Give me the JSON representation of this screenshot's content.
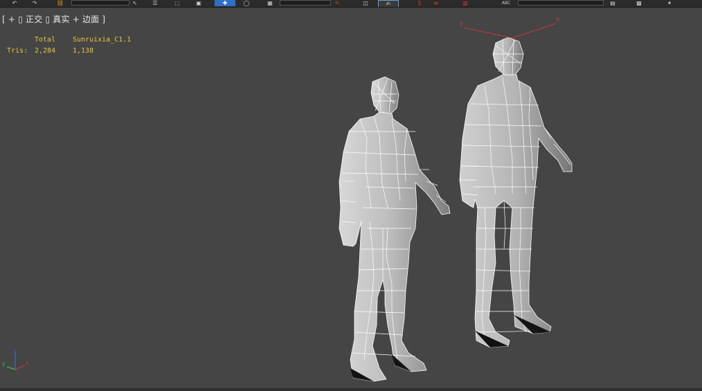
{
  "toolbar": {
    "items": [
      {
        "name": "undo-icon",
        "glyph": "↶"
      },
      {
        "name": "redo-icon",
        "glyph": "↷"
      },
      {
        "name": "link-icon",
        "glyph": "⛓"
      },
      {
        "name": "select-object-icon",
        "glyph": "↖"
      },
      {
        "name": "select-by-name-icon",
        "glyph": "☰"
      },
      {
        "name": "rect-selection-icon",
        "glyph": "⬚"
      },
      {
        "name": "window-crossing-icon",
        "glyph": "▣"
      },
      {
        "name": "move-icon",
        "glyph": "✚"
      },
      {
        "name": "rotate-icon",
        "glyph": "◯"
      },
      {
        "name": "reference-coord-icon",
        "glyph": "▦"
      },
      {
        "name": "snap-icon",
        "glyph": "✎"
      },
      {
        "name": "mirror-icon",
        "glyph": "◫"
      },
      {
        "name": "named-selection-icon",
        "glyph": "✍"
      },
      {
        "name": "align-icon",
        "glyph": "⫼"
      },
      {
        "name": "layer-icon",
        "glyph": "≡"
      },
      {
        "name": "abc-icon",
        "glyph": "ABC"
      },
      {
        "name": "curve-editor-icon",
        "glyph": "▥"
      },
      {
        "name": "render-setup-icon",
        "glyph": "▤"
      },
      {
        "name": "render-frame-icon",
        "glyph": "▩"
      },
      {
        "name": "render-icon",
        "glyph": "✦"
      }
    ],
    "colors": {
      "active": "#2f6fc6"
    }
  },
  "viewport": {
    "label_bracket_open": "[",
    "label_plus": "+",
    "label_view_marker": "▯",
    "label_view": "正交",
    "label_shading_marker": "▯",
    "label_shading": "真实",
    "label_plus2": "+",
    "label_edges": "边面",
    "label_bracket_close": "]"
  },
  "stats": {
    "header_total": "Total",
    "header_object": "Sunruixia_C1.1",
    "row_label": "Tris:",
    "total_tris": "2,284",
    "object_tris": "1,138",
    "color": "#e8c63a"
  },
  "gizmo": {
    "axis_x": "x",
    "axis_y": "y",
    "color": "#c83a3a"
  },
  "axis_tripod": {
    "x": "x",
    "y": "y",
    "z": "z",
    "colors": {
      "x": "#d03a3a",
      "y": "#3ac03a",
      "z": "#3a6ad0"
    }
  },
  "models": [
    {
      "name": "character-left"
    },
    {
      "name": "character-right"
    }
  ]
}
